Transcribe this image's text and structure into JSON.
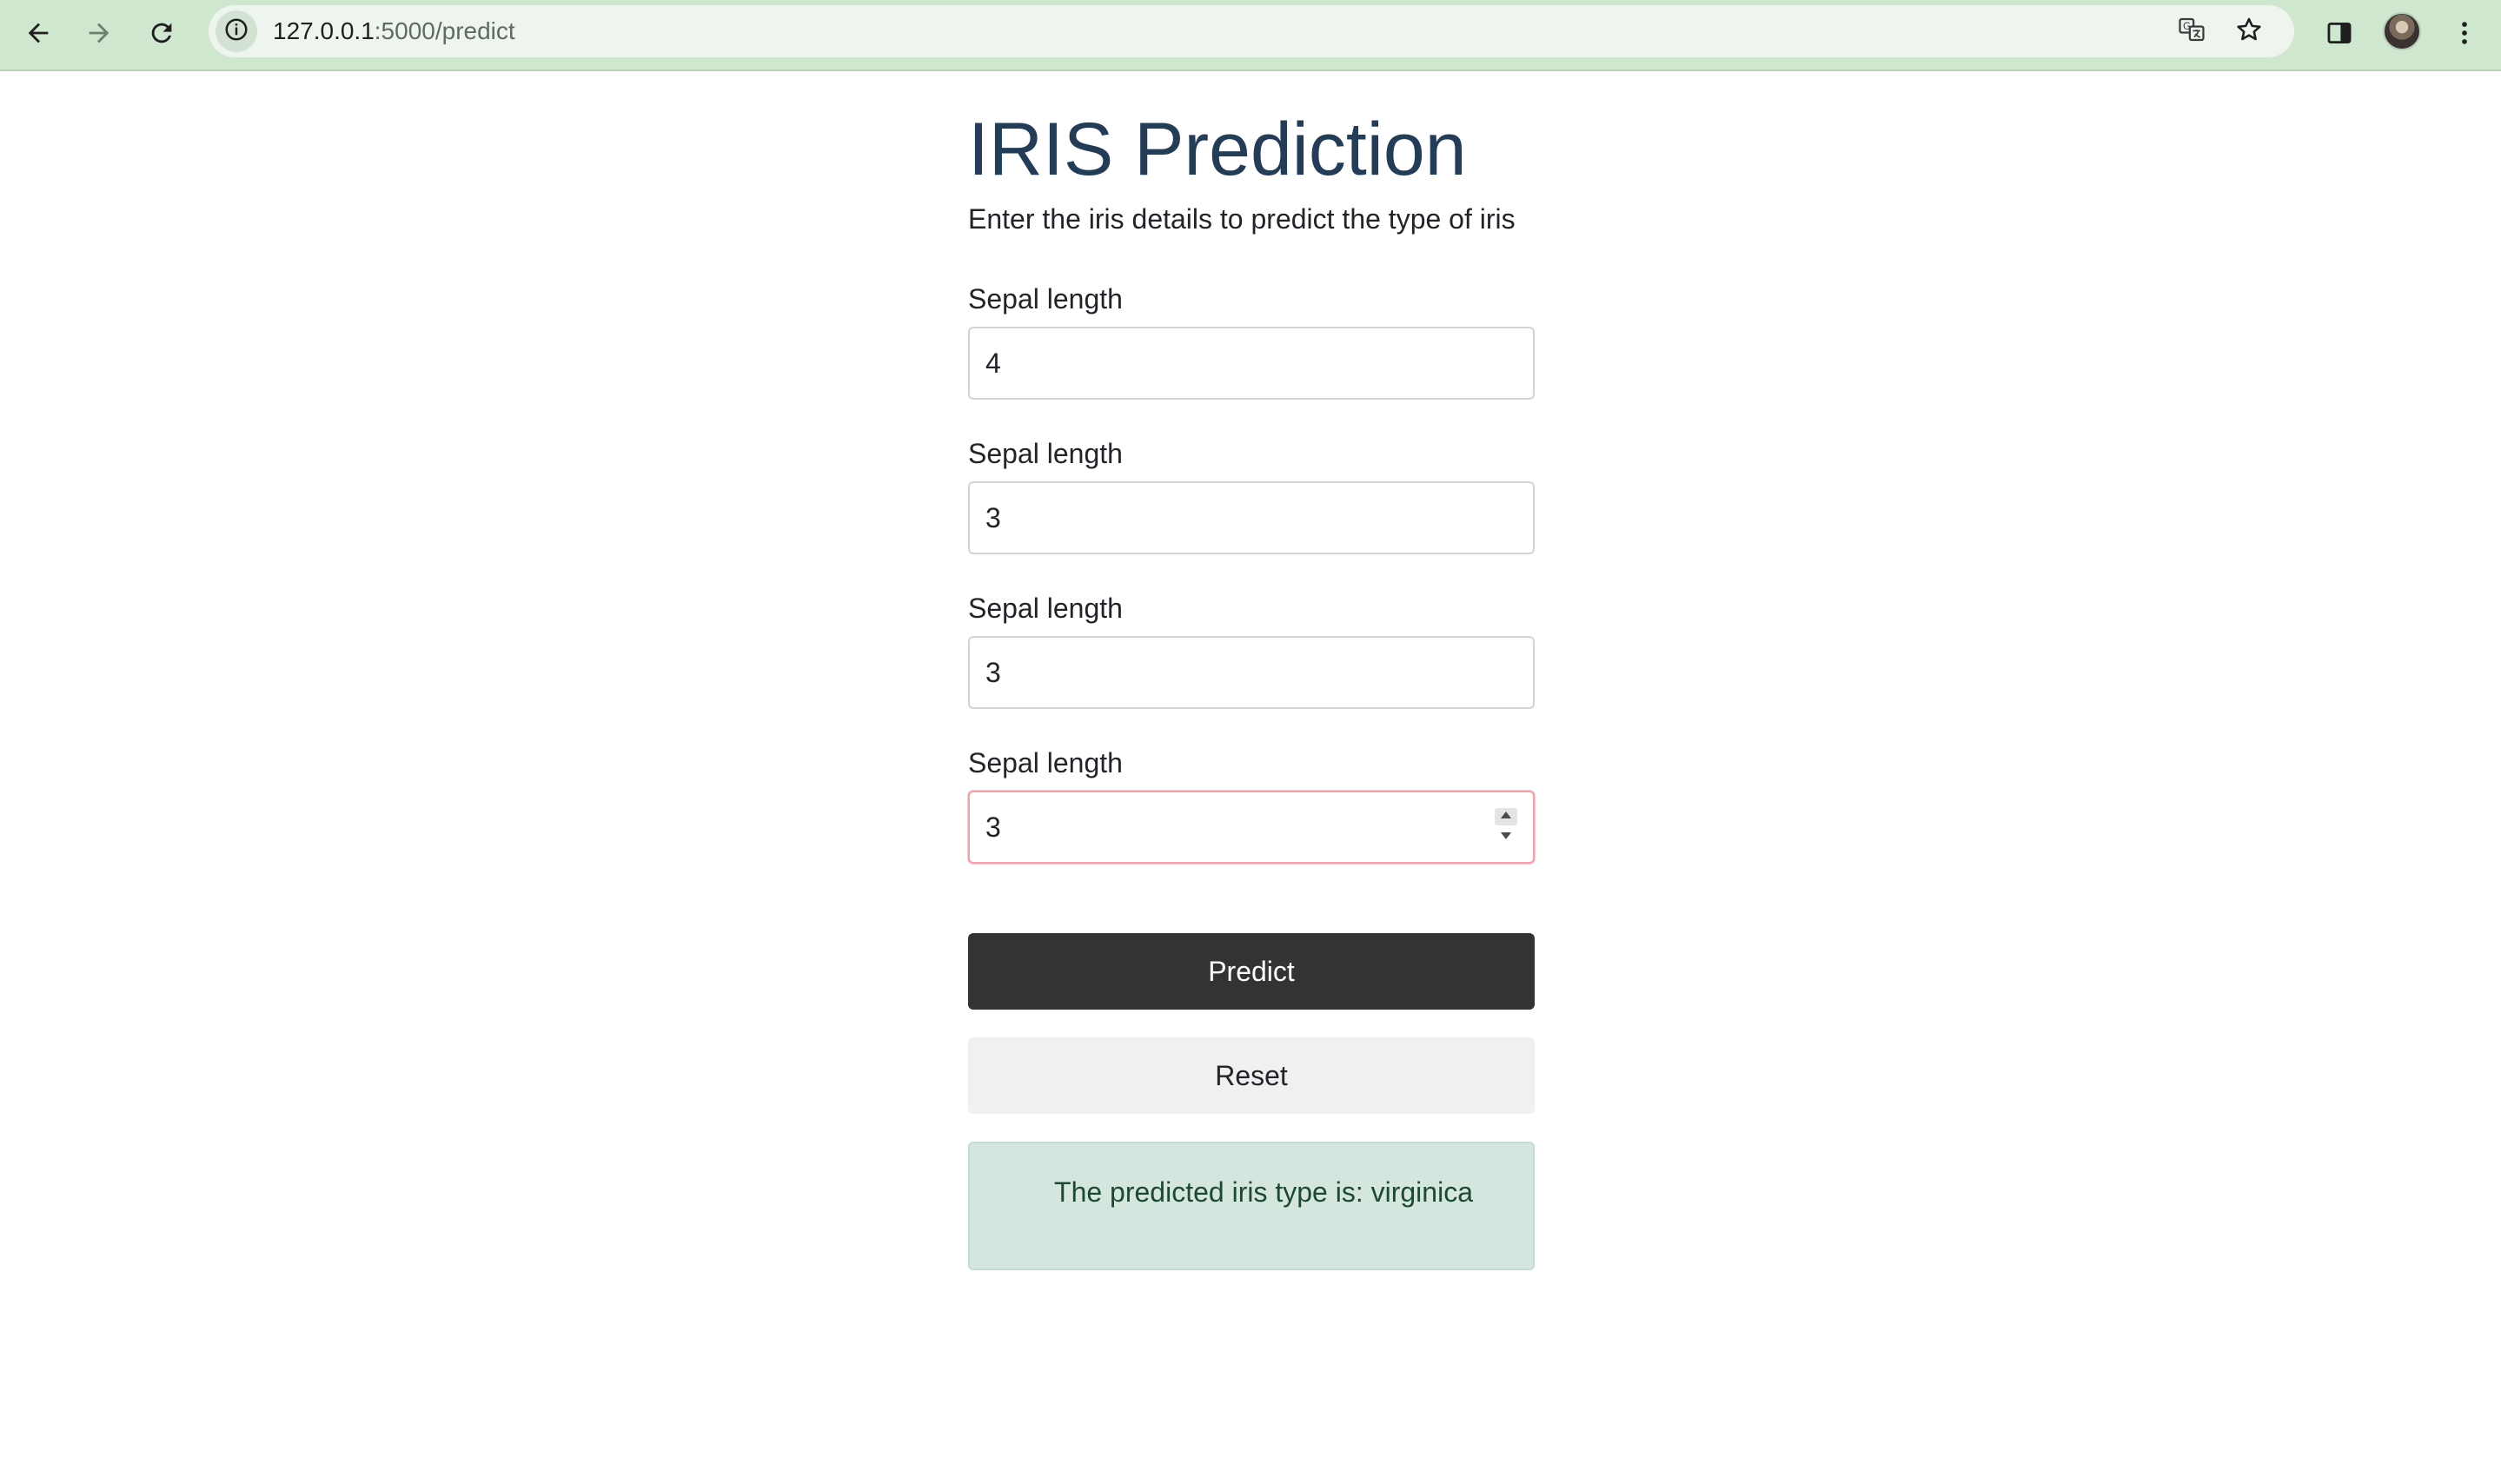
{
  "browser": {
    "url_host": "127.0.0.1",
    "url_path": ":5000/predict"
  },
  "page": {
    "title": "IRIS Prediction",
    "subtitle": "Enter the iris details to predict the type of iris"
  },
  "form": {
    "fields": [
      {
        "label": "Sepal length",
        "value": "4"
      },
      {
        "label": "Sepal length",
        "value": "3"
      },
      {
        "label": "Sepal length",
        "value": "3"
      },
      {
        "label": "Sepal length",
        "value": "3"
      }
    ],
    "predict_label": "Predict",
    "reset_label": "Reset"
  },
  "result": {
    "text": "The predicted iris type is: virginica"
  },
  "colors": {
    "toolbar": "#cfe6cf",
    "title": "#233d58",
    "predict_button": "#333333",
    "reset_button": "#f0f0f0",
    "result_bg": "#d4e6de",
    "result_text": "#1c4a30",
    "focus_border": "#f2a0a6"
  },
  "icons": {
    "back": "arrow-left-icon",
    "forward": "arrow-right-icon",
    "reload": "reload-icon",
    "site_info": "info-icon",
    "translate": "translate-icon",
    "bookmark": "star-icon",
    "side_panel": "side-panel-icon",
    "profile": "avatar",
    "menu": "kebab-menu-icon"
  }
}
